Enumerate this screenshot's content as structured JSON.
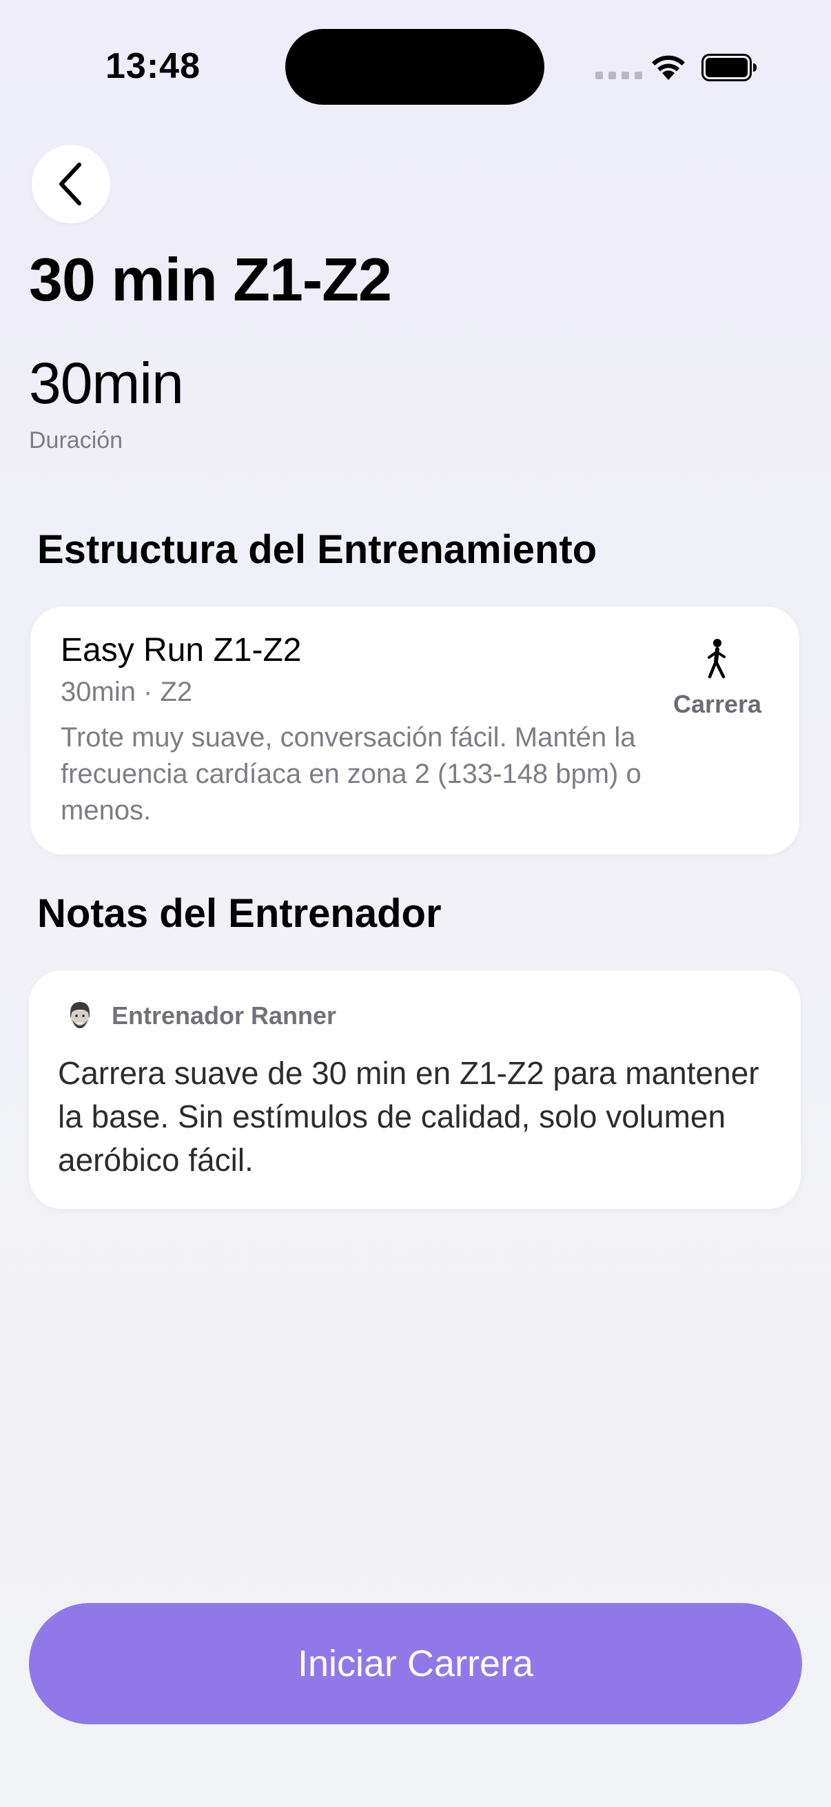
{
  "status_bar": {
    "time": "13:48"
  },
  "header": {
    "back_icon": "chevron-left-icon"
  },
  "workout": {
    "title": "30 min Z1-Z2",
    "duration_value": "30min",
    "duration_label": "Duración"
  },
  "structure": {
    "section_title": "Estructura del Entrenamiento",
    "steps": [
      {
        "name": "Easy Run Z1-Z2",
        "meta": "30min · Z2",
        "description": "Trote muy suave, conversación fácil. Mantén la frecuencia cardíaca en zona 2 (133-148 bpm) o menos.",
        "type_icon": "walking-person-icon",
        "type_label": "Carrera"
      }
    ]
  },
  "notes": {
    "section_title": "Notas del Entrenador",
    "coach_avatar": "coach-avatar-icon",
    "coach_name": "Entrenador Ranner",
    "text": "Carrera suave de 30 min en Z1-Z2 para mantener la base. Sin estímulos de calidad, solo volumen aeróbico fácil."
  },
  "actions": {
    "start_label": "Iniciar Carrera"
  },
  "colors": {
    "accent": "#9178e8",
    "background": "#eeedf9",
    "card": "#ffffff"
  }
}
